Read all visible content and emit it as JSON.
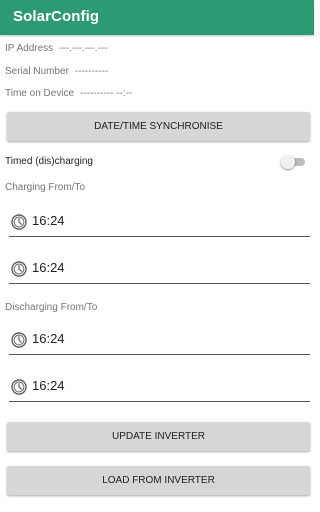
{
  "appbar": {
    "title": "SolarConfig",
    "color": "#2e9a73"
  },
  "info": {
    "ip_label": "IP Address",
    "ip_value": "---.---.---.---",
    "serial_label": "Serial Number",
    "serial_value": "----------",
    "time_label": "Time on Device",
    "time_value": "---------- --:--"
  },
  "buttons": {
    "sync": "DATE/TIME SYNCHRONISE",
    "update": "UPDATE INVERTER",
    "load": "LOAD FROM INVERTER"
  },
  "timed": {
    "label": "Timed (dis)charging",
    "enabled": false
  },
  "charging": {
    "label": "Charging From/To",
    "from": "16:24",
    "to": "16:24"
  },
  "discharging": {
    "label": "Discharging From/To",
    "from": "16:24",
    "to": "16:24"
  },
  "icons": {
    "time_field": "clock-icon"
  }
}
